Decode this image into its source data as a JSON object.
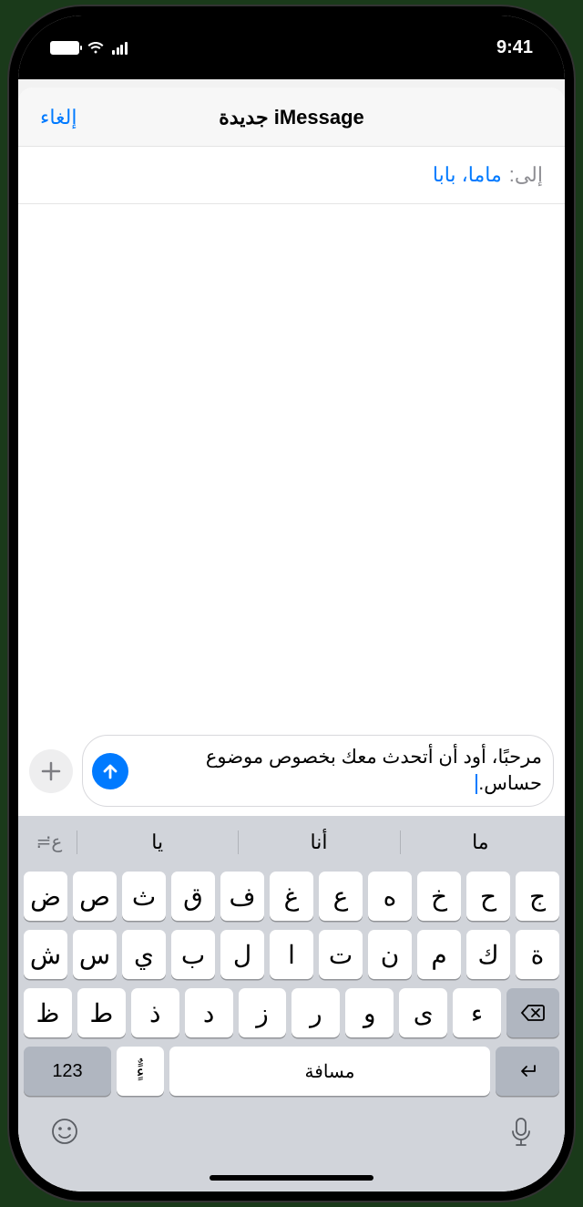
{
  "status": {
    "time": "9:41"
  },
  "nav": {
    "cancel": "إلغاء",
    "title": "iMessage جديدة"
  },
  "to": {
    "label": "إلى:",
    "value": "ماما، بابا"
  },
  "compose": {
    "text": "مرحبًا، أود أن أتحدث معك بخصوص موضوع حساس."
  },
  "predict": {
    "p1": "ما",
    "p2": "أنا",
    "p3": "يا",
    "emoji_label": "ع≒"
  },
  "keys": {
    "r1": [
      "ج",
      "ح",
      "خ",
      "ه",
      "ع",
      "غ",
      "ف",
      "ق",
      "ث",
      "ص",
      "ض"
    ],
    "r2": [
      "ة",
      "ك",
      "م",
      "ن",
      "ت",
      "ا",
      "ل",
      "ب",
      "ي",
      "س",
      "ش"
    ],
    "r3": [
      "ء",
      "ى",
      "و",
      "ر",
      "ز",
      "د",
      "ذ",
      "ط",
      "ظ"
    ],
    "space": "مسافة",
    "num": "123",
    "diacritic": "ءًٌٍ"
  }
}
